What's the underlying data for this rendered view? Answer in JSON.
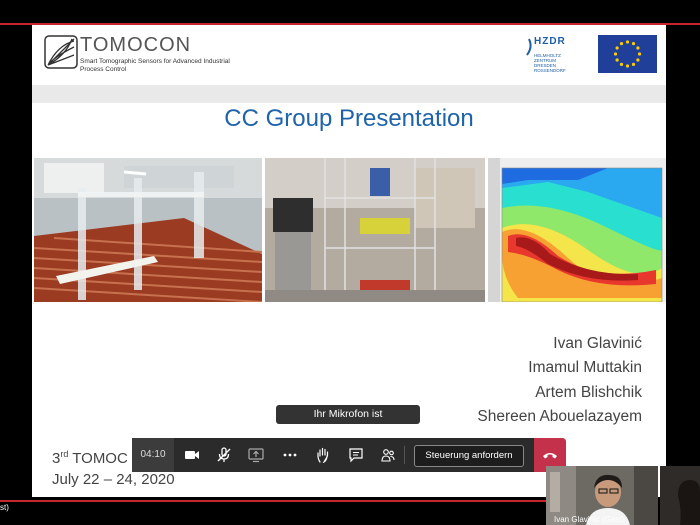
{
  "slide": {
    "logo_title": "TOMOCON",
    "logo_subtitle": "Smart Tomographic Sensors for Advanced Industrial Process Control",
    "hzdr_title": "HZDR",
    "hzdr_subtitle": "HELMHOLTZ ZENTRUM DRESDEN ROSSENDORF",
    "title": "CC Group Presentation",
    "authors": [
      "Ivan Glavinić",
      "Imamul Muttakin",
      "Artem Blishchik",
      "Shereen Abouelazayem"
    ],
    "conference_prefix": "3",
    "conference_sup": "rd",
    "conference_rest": " TOMOC",
    "dates": "July 22 – 24, 2020",
    "accent_blue": "#1f63a8"
  },
  "tooltip": "Ihr Mikrofon ist stummgeschaltet.",
  "meeting_bar": {
    "timer": "04:10",
    "request_control_label": "Steuerung anfordern",
    "icons": [
      "video-camera-icon",
      "microphone-muted-icon",
      "share-screen-icon",
      "more-icon",
      "raise-hand-icon",
      "chat-icon",
      "participants-icon",
      "hang-up-icon"
    ],
    "hangup_color": "#c4314b"
  },
  "participant": {
    "name": "Ivan Glavinic (Gast)",
    "left_label": "st)"
  },
  "accent_red": "#c4262e"
}
